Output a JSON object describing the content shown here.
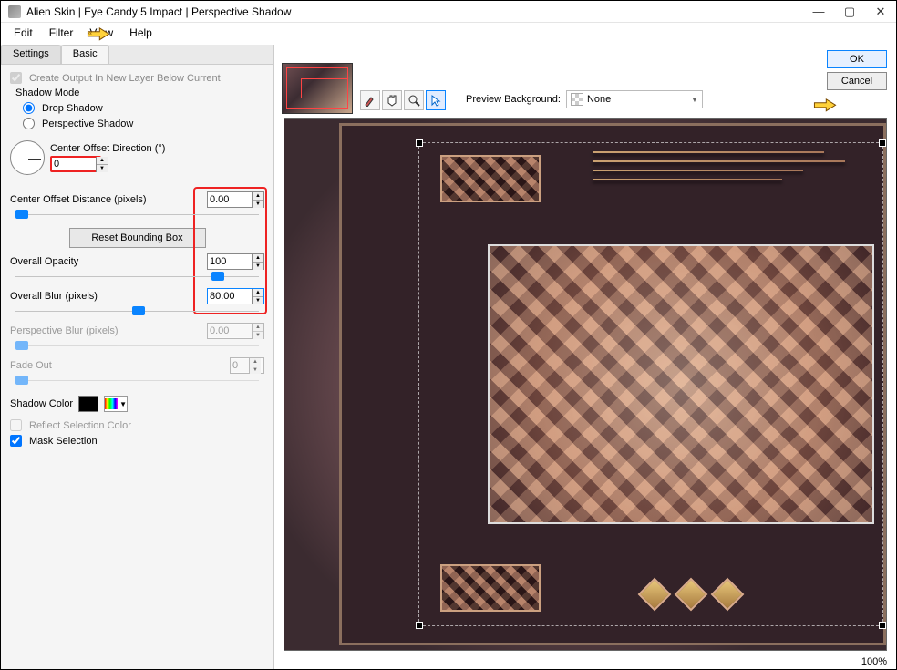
{
  "title": "Alien Skin | Eye Candy 5 Impact | Perspective Shadow",
  "menubar": {
    "edit": "Edit",
    "filter": "Filter",
    "view": "View",
    "help": "Help"
  },
  "tabs": {
    "settings": "Settings",
    "basic": "Basic"
  },
  "checks": {
    "create_output": "Create Output In New Layer Below Current",
    "reflect": "Reflect Selection Color",
    "mask": "Mask Selection"
  },
  "shadow_mode": {
    "label": "Shadow Mode",
    "drop": "Drop Shadow",
    "perspective": "Perspective Shadow"
  },
  "params": {
    "center_dir_label": "Center Offset Direction (°)",
    "center_dir_value": "0",
    "center_dist_label": "Center Offset Distance (pixels)",
    "center_dist_value": "0.00",
    "reset_btn": "Reset Bounding Box",
    "opacity_label": "Overall Opacity",
    "opacity_value": "100",
    "blur_label": "Overall Blur (pixels)",
    "blur_value": "80.00",
    "pblur_label": "Perspective Blur (pixels)",
    "pblur_value": "0.00",
    "fade_label": "Fade Out",
    "fade_value": "0",
    "shadow_color_label": "Shadow Color"
  },
  "preview_bg": {
    "label": "Preview Background:",
    "value": "None"
  },
  "buttons": {
    "ok": "OK",
    "cancel": "Cancel"
  },
  "zoom": "100%"
}
